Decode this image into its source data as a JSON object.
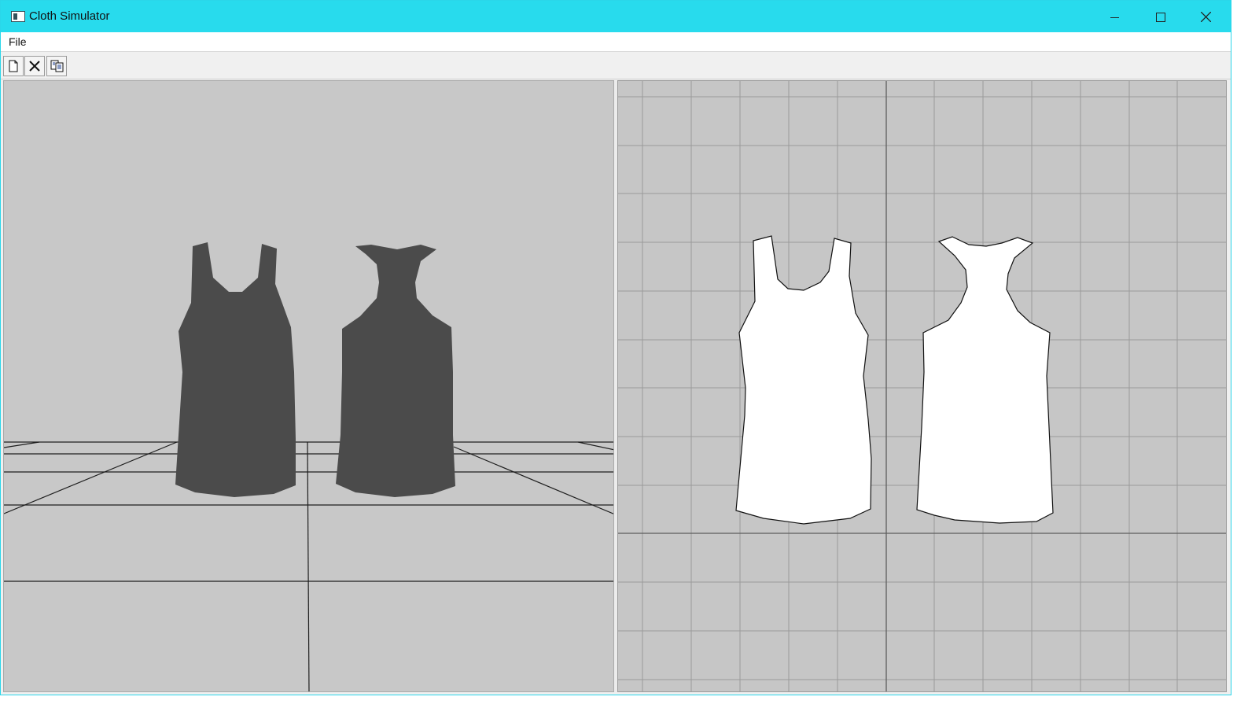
{
  "window": {
    "title": "Cloth Simulator",
    "icon": "app-window-icon",
    "accent_color": "#28dbed"
  },
  "controls": {
    "minimize_icon": "minimize-icon",
    "maximize_icon": "maximize-icon",
    "close_icon": "close-icon"
  },
  "menu": {
    "items": [
      "File"
    ]
  },
  "toolbar": {
    "buttons": [
      {
        "icon": "new-document-icon"
      },
      {
        "icon": "delete-x-icon"
      },
      {
        "icon": "copy-icon"
      }
    ]
  },
  "viewports": {
    "left": {
      "name": "3d-view",
      "background": "#c8c8c8",
      "garment_color": "#4b4b4b",
      "garments": [
        "tank-top-front",
        "tank-top-back"
      ]
    },
    "right": {
      "name": "2d-pattern-view",
      "background": "#c6c6c6",
      "grid_color": "#9a9a9a",
      "pattern_color": "#ffffff",
      "patterns": [
        "tank-top-front-pattern",
        "tank-top-back-pattern"
      ]
    }
  }
}
